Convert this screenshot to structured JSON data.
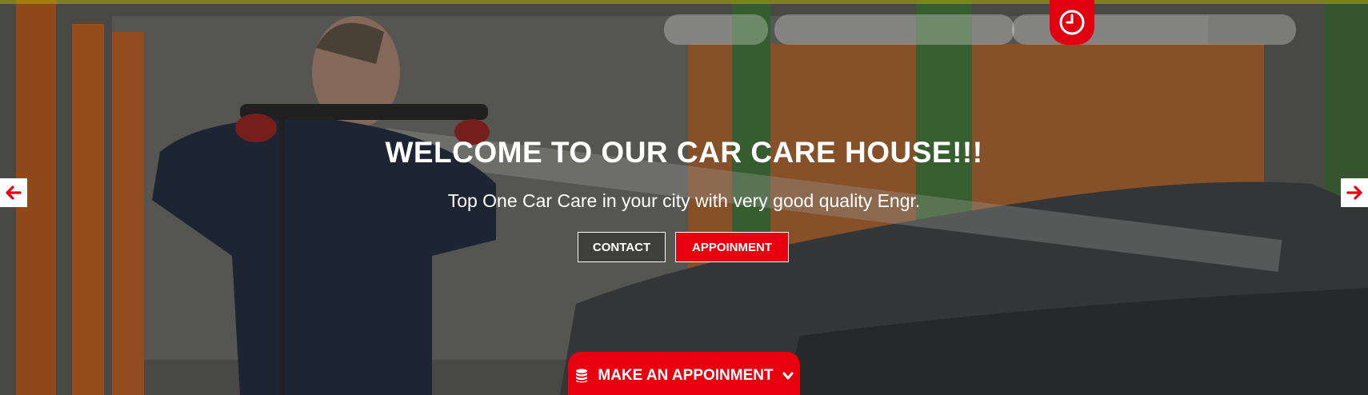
{
  "hero": {
    "title": "WELCOME TO OUR CAR CARE HOUSE!!!",
    "subtitle": "Top One Car Care in your city with very good quality Engr.",
    "buttons": {
      "contact_label": "CONTACT",
      "appointment_label": "APPOINMENT"
    }
  },
  "slider": {
    "prev_icon": "arrow-left-icon",
    "next_icon": "arrow-right-icon"
  },
  "top_badge": {
    "icon": "clock-icon"
  },
  "bottom_tab": {
    "icon": "database-icon",
    "label": "MAKE AN APPOINMENT",
    "chevron_icon": "chevron-down-icon"
  },
  "colors": {
    "accent": "#e8000f",
    "text": "#ffffff"
  }
}
